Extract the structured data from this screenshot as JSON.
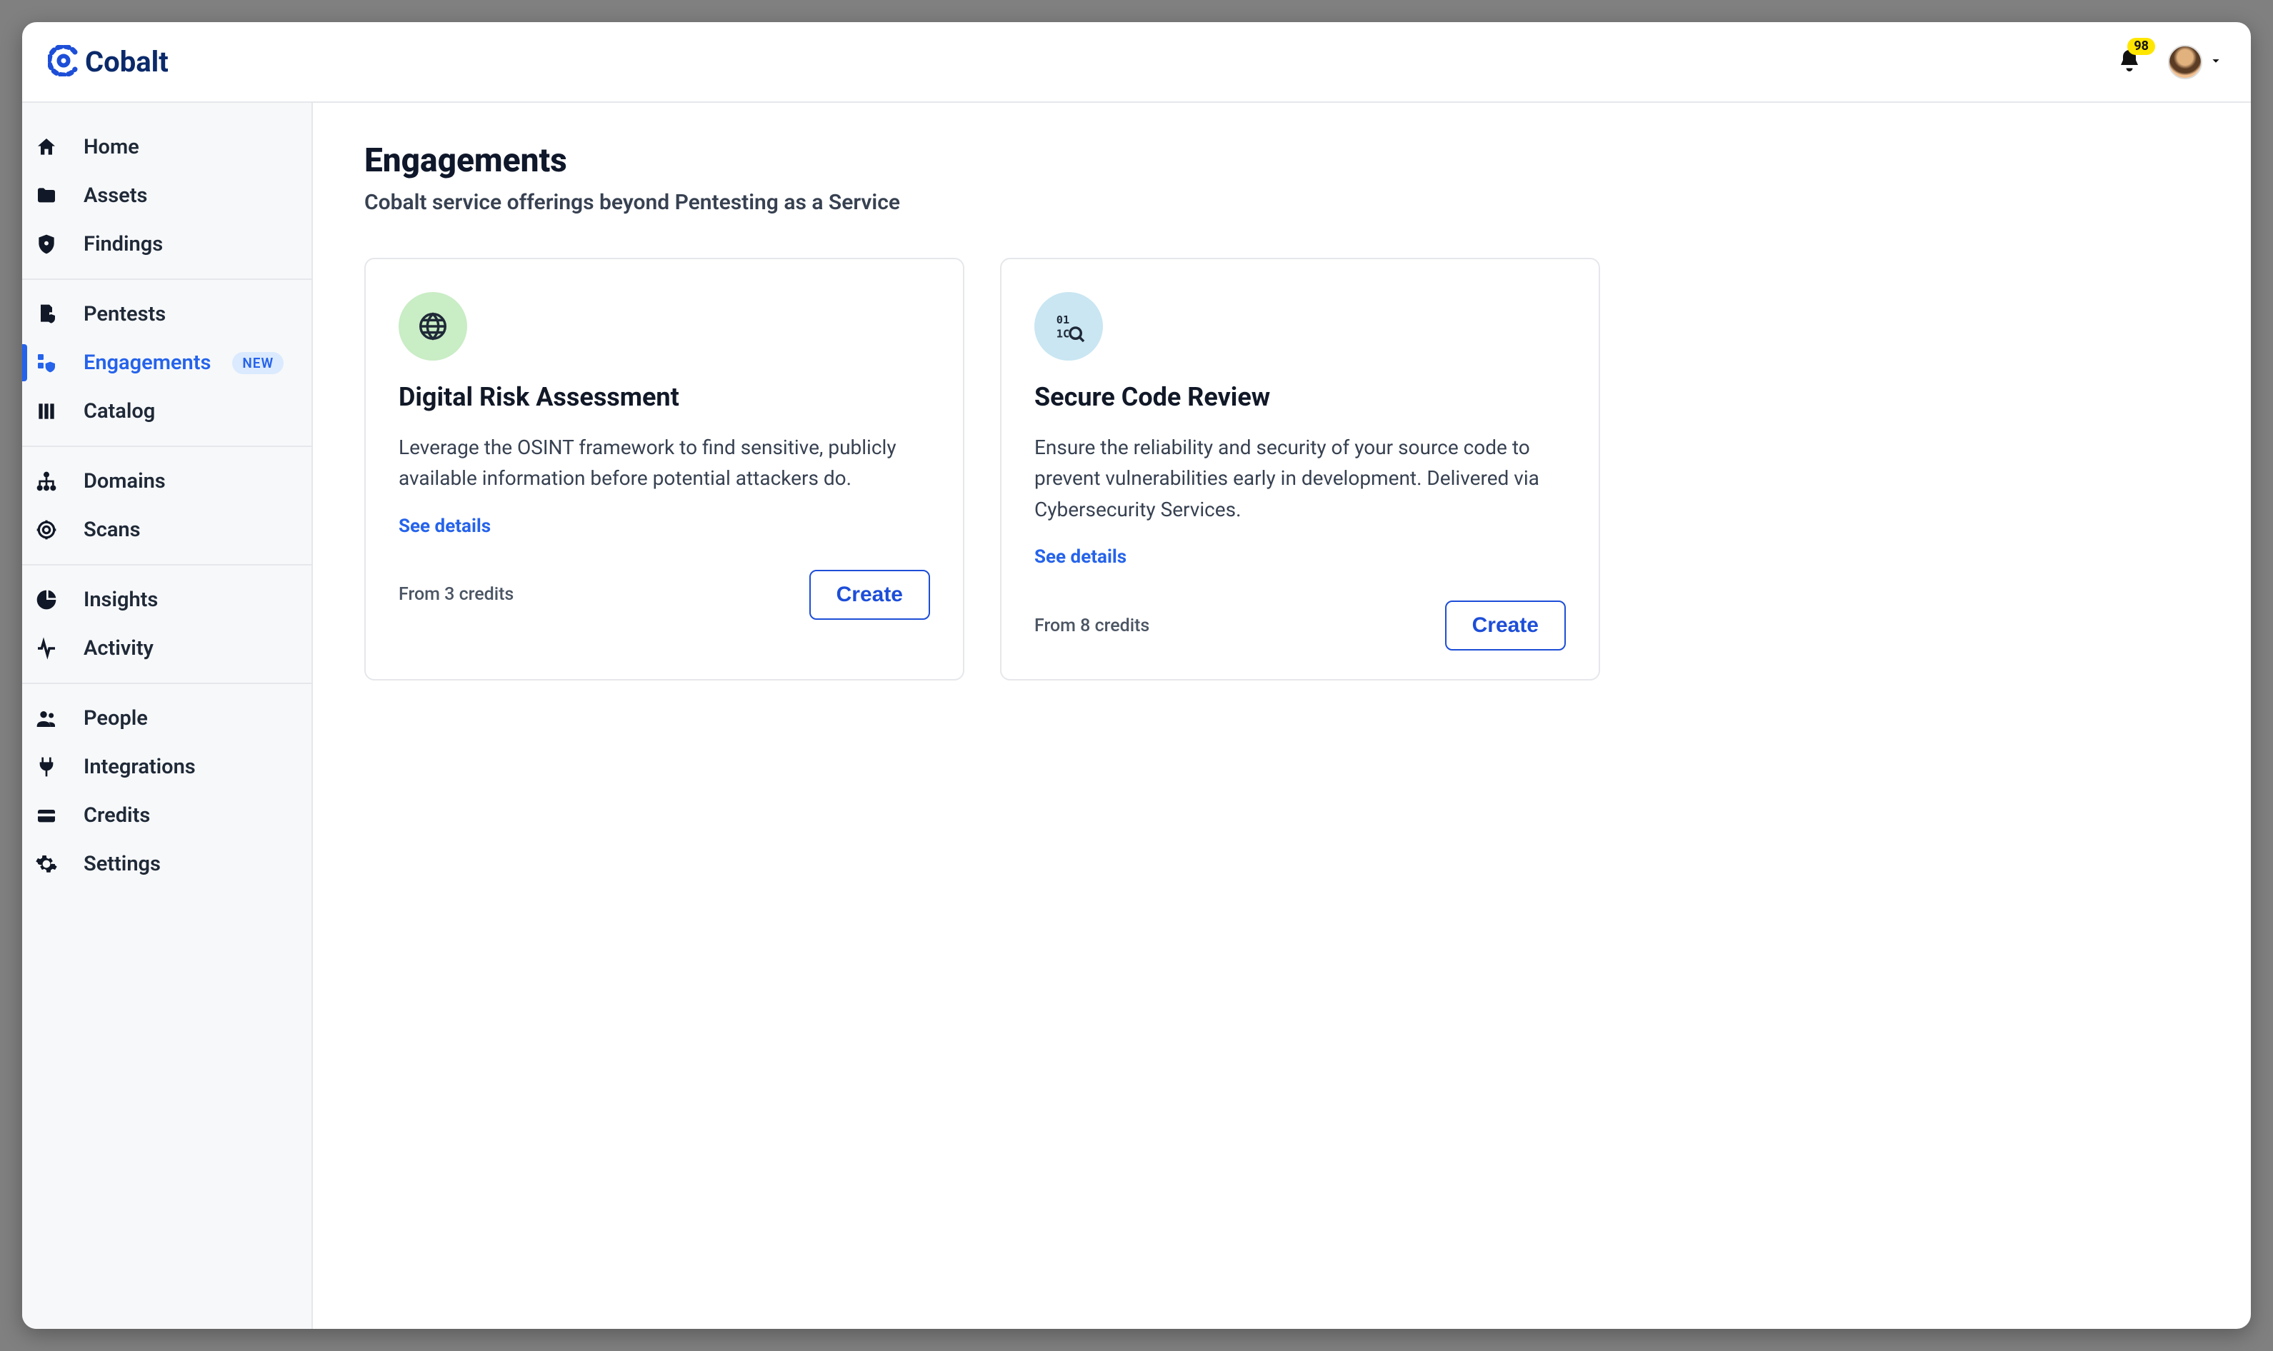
{
  "brand": {
    "name": "Cobalt"
  },
  "header": {
    "notification_count": "98"
  },
  "sidebar": {
    "groups": [
      {
        "items": [
          {
            "key": "home",
            "label": "Home"
          },
          {
            "key": "assets",
            "label": "Assets"
          },
          {
            "key": "findings",
            "label": "Findings"
          }
        ]
      },
      {
        "items": [
          {
            "key": "pentests",
            "label": "Pentests"
          },
          {
            "key": "engagements",
            "label": "Engagements",
            "active": true,
            "badge": "NEW"
          },
          {
            "key": "catalog",
            "label": "Catalog"
          }
        ]
      },
      {
        "items": [
          {
            "key": "domains",
            "label": "Domains"
          },
          {
            "key": "scans",
            "label": "Scans"
          }
        ]
      },
      {
        "items": [
          {
            "key": "insights",
            "label": "Insights"
          },
          {
            "key": "activity",
            "label": "Activity"
          }
        ]
      },
      {
        "items": [
          {
            "key": "people",
            "label": "People"
          },
          {
            "key": "integrations",
            "label": "Integrations"
          },
          {
            "key": "credits",
            "label": "Credits"
          },
          {
            "key": "settings",
            "label": "Settings"
          }
        ]
      }
    ]
  },
  "page": {
    "title": "Engagements",
    "subtitle": "Cobalt service offerings beyond Pentesting as a Service"
  },
  "cards": [
    {
      "icon": "globe",
      "icon_color": "green",
      "title": "Digital Risk Assessment",
      "description": "Leverage the OSINT framework to find sensitive, publicly available information before potential attackers do.",
      "see_details_label": "See details",
      "credits_text": "From 3 credits",
      "create_label": "Create"
    },
    {
      "icon": "binary-magnify",
      "icon_color": "blue",
      "title": "Secure Code Review",
      "description": "Ensure the reliability and security of your source code to prevent vulnerabilities early in development. Delivered via Cybersecurity Services.",
      "see_details_label": "See details",
      "credits_text": "From 8 credits",
      "create_label": "Create"
    }
  ]
}
